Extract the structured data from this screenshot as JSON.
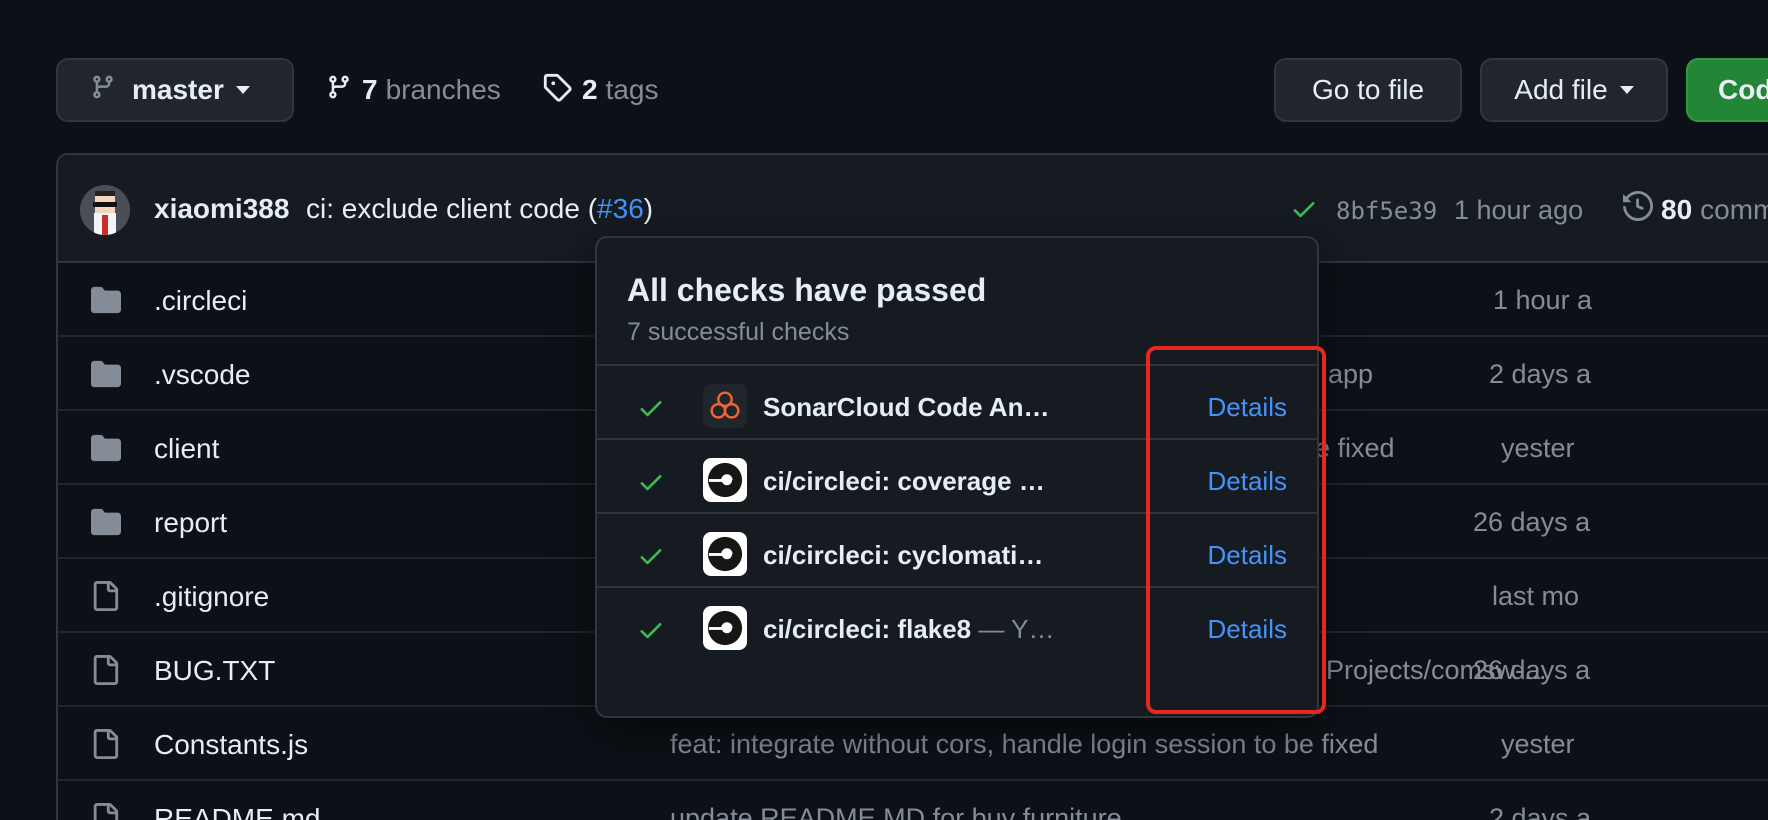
{
  "toolbar": {
    "branch": "master",
    "branches_count": "7",
    "branches_label": "branches",
    "tags_count": "2",
    "tags_label": "tags",
    "go_to_file": "Go to file",
    "add_file": "Add file",
    "code": "Cod"
  },
  "commit": {
    "author": "xiaomi388",
    "message_prefix": "ci: exclude client code (",
    "pr": "#36",
    "message_suffix": ")",
    "sha": "8bf5e39",
    "time": "1 hour ago",
    "commits_count": "80",
    "commits_label": "comm"
  },
  "files": [
    {
      "name": ".circleci",
      "type": "folder",
      "commit": "",
      "age": "1 hour a"
    },
    {
      "name": ".vscode",
      "type": "folder",
      "commit": "app",
      "age": "2 days a"
    },
    {
      "name": "client",
      "type": "folder",
      "commit": "be fixed",
      "age": "yester"
    },
    {
      "name": "report",
      "type": "folder",
      "commit": "",
      "age": "26 days a"
    },
    {
      "name": ".gitignore",
      "type": "file",
      "commit": "",
      "age": "last mo"
    },
    {
      "name": "BUG.TXT",
      "type": "file",
      "commit": "Projects/comsw-...",
      "age": "26 days a"
    },
    {
      "name": "Constants.js",
      "type": "file",
      "commit": "feat: integrate without cors, handle login session to be fixed",
      "age": "yester"
    },
    {
      "name": "README.md",
      "type": "file",
      "commit": "update README.MD for buy furniture",
      "age": "2 days a"
    }
  ],
  "popover": {
    "title": "All checks have passed",
    "subtitle": "7 successful checks",
    "checks": [
      {
        "name": "SonarCloud Code An…",
        "suffix": "",
        "details": "Details",
        "icon": "sonarcloud-icon"
      },
      {
        "name": "ci/circleci: coverage …",
        "suffix": "",
        "details": "Details",
        "icon": "circleci-icon"
      },
      {
        "name": "ci/circleci: cyclomati…",
        "suffix": "",
        "details": "Details",
        "icon": "circleci-icon"
      },
      {
        "name": "ci/circleci: flake8",
        "suffix": " — Y…",
        "details": "Details",
        "icon": "circleci-icon"
      }
    ]
  },
  "colors": {
    "background": "#0d1117",
    "accent_link": "#4493f8",
    "success": "#3fb950",
    "primary_button": "#238636",
    "highlight_box": "#e5281f"
  }
}
